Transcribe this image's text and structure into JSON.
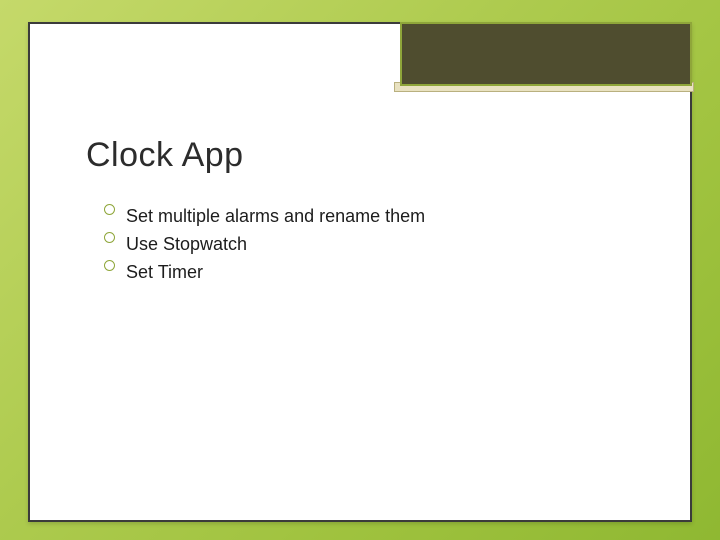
{
  "slide": {
    "title": "Clock App",
    "bullets": [
      "Set multiple alarms and rename them",
      "Use Stopwatch",
      "Set Timer"
    ]
  }
}
